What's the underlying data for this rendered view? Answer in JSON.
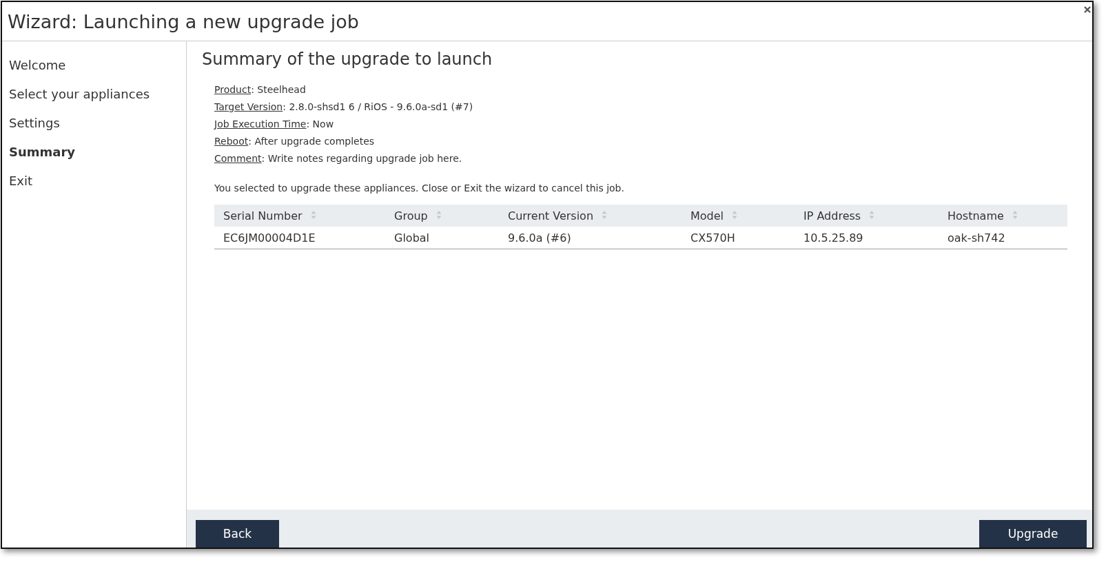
{
  "window": {
    "title": "Wizard: Launching a new upgrade job"
  },
  "sidebar": {
    "items": [
      {
        "label": "Welcome",
        "selected": false
      },
      {
        "label": "Select your appliances",
        "selected": false
      },
      {
        "label": "Settings",
        "selected": false
      },
      {
        "label": "Summary",
        "selected": true
      },
      {
        "label": "Exit",
        "selected": false
      }
    ]
  },
  "heading": "Summary of the upgrade to launch",
  "summary": [
    {
      "label": "Product",
      "value": ": Steelhead"
    },
    {
      "label": "Target Version",
      "value": ": 2.8.0-shsd1 6 / RiOS - 9.6.0a-sd1 (#7)"
    },
    {
      "label": "Job Execution Time",
      "value": ": Now"
    },
    {
      "label": "Reboot",
      "value": ": After upgrade completes"
    },
    {
      "label": "Comment",
      "value": ": Write notes regarding upgrade job here."
    }
  ],
  "note": "You selected to upgrade these appliances. Close or Exit the wizard to cancel this job.",
  "table": {
    "columns": [
      "Serial Number",
      "Group",
      "Current Version",
      "Model",
      "IP Address",
      "Hostname"
    ],
    "rows": [
      [
        "EC6JM00004D1E",
        "Global",
        "9.6.0a (#6)",
        "CX570H",
        "10.5.25.89",
        "oak-sh742"
      ]
    ]
  },
  "buttons": {
    "back": "Back",
    "upgrade": "Upgrade"
  }
}
